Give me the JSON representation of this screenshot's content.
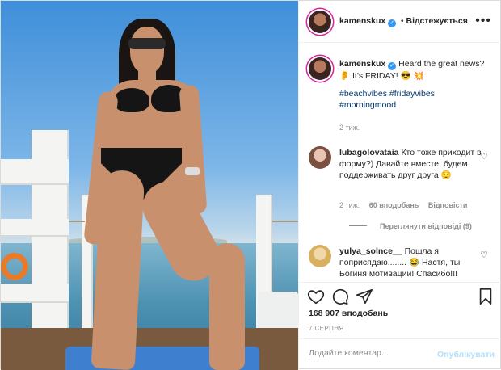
{
  "post": {
    "author": "kamenskux",
    "follow_state": "Відстежується",
    "separator": "•"
  },
  "caption": {
    "username": "kamenskux",
    "text": "Heard the great news? 👂 It's FRIDAY! 😎 💥",
    "hashtags": [
      "#beachvibes",
      "#fridayvibes",
      "#morningmood"
    ],
    "time": "2 тиж."
  },
  "comments": [
    {
      "username": "lubagolovataia",
      "text": "Кто тоже приходит в форму?) Давайте вместе, будем поддерживать друг друга 😌",
      "time": "2 тиж.",
      "likes": "60 вподобань",
      "reply": "Відповісти",
      "view_replies": "Переглянути відповіді (9)"
    },
    {
      "username": "yulya_solnce__",
      "text": "Пошла я поприсядаю........ 😂 Настя, ты Богиня мотивации! Спасибо!!!"
    }
  ],
  "stats": {
    "likes": "168 907 вподобань",
    "date": "7 СЕРПНЯ"
  },
  "comment_box": {
    "placeholder": "Додайте коментар...",
    "publish": "Опублікувати"
  },
  "icons": {
    "verified": "verified-badge-icon",
    "more": "more-options-icon",
    "like": "heart-icon",
    "comment": "comment-icon",
    "share": "paper-plane-icon",
    "save": "bookmark-icon"
  },
  "colors": {
    "verified": "#3897f0",
    "link": "#00376b",
    "muted": "#8e8e8e",
    "publish_disabled": "#b2dffc"
  }
}
